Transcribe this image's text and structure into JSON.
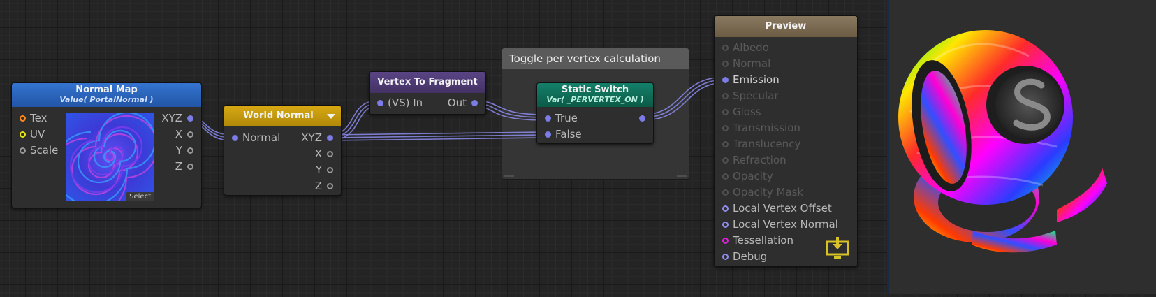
{
  "normal_map": {
    "title": "Normal Map",
    "subtitle": "Value( PortalNormal )",
    "inputs": [
      "Tex",
      "UV",
      "Scale"
    ],
    "outputs": [
      "XYZ",
      "X",
      "Y",
      "Z"
    ],
    "select_label": "Select"
  },
  "world_normal": {
    "title": "World Normal",
    "input": "Normal",
    "outputs": [
      "XYZ",
      "X",
      "Y",
      "Z"
    ]
  },
  "vertex_to_fragment": {
    "title": "Vertex To Fragment",
    "input": "(VS) In",
    "output": "Out"
  },
  "group": {
    "title": "Toggle per vertex calculation"
  },
  "static_switch": {
    "title": "Static Switch",
    "subtitle": "Var( _PERVERTEX_ON )",
    "inputs": [
      "True",
      "False"
    ]
  },
  "preview_node": {
    "title": "Preview",
    "ports": [
      "Albedo",
      "Normal",
      "Emission",
      "Specular",
      "Gloss",
      "Transmission",
      "Translucency",
      "Refraction",
      "Opacity",
      "Opacity Mask",
      "Local Vertex Offset",
      "Local Vertex Normal",
      "Tessellation",
      "Debug"
    ]
  },
  "icons": {
    "dropdown": "dropdown-arrow-icon",
    "save": "download-to-screen-icon",
    "preview_logo": "s-logo-icon"
  },
  "colors": {
    "connected_port": "#7b7ce6",
    "wire": "#8c8cf0",
    "normal_map_header": "#2a63b8",
    "world_normal_header": "#c59a0f",
    "vertex_to_fragment_header": "#4e3a72",
    "static_switch_header": "#0d6b52",
    "preview_header": "#7a6a52"
  }
}
